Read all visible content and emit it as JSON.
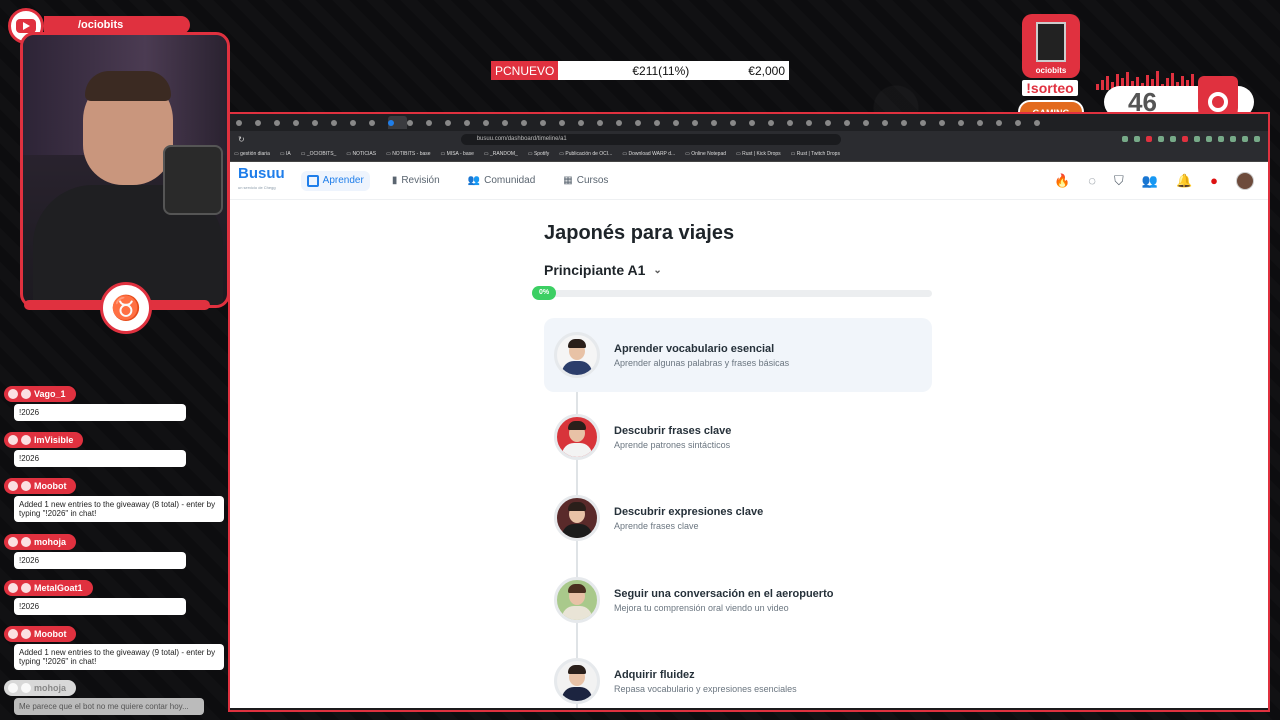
{
  "overlay": {
    "channel": "/ociobits",
    "donation": {
      "label": "PCNUEVO",
      "progress": "€211(11%)",
      "goal": "€2,000"
    },
    "sorteo_label": "!sorteo",
    "sorteo_brand": "ociobits",
    "gaming_label": "GAMING",
    "viewer_count": "46",
    "chat": [
      {
        "user": "Vago_1",
        "text": "!2026"
      },
      {
        "user": "ImVisible",
        "text": "!2026"
      },
      {
        "user": "Moobot",
        "text": "Added 1 new entries to the giveaway (8 total) - enter by typing \"!2026\" in chat!"
      },
      {
        "user": "mohoja",
        "text": "!2026"
      },
      {
        "user": "MetalGoat1",
        "text": "!2026"
      },
      {
        "user": "Moobot",
        "text": "Added 1 new entries to the giveaway (9 total) - enter by typing \"!2026\" in chat!"
      },
      {
        "user": "mohoja",
        "text": "Me parece que el bot no me quiere contar hoy..."
      }
    ]
  },
  "browser": {
    "url": "busuu.com/dashboard/timeline/a1",
    "bookmarks": [
      "gestión diaria",
      "IA",
      "_OCIOBITS_",
      "NOTICIAS",
      "NOTIBITS - base",
      "MISA - base",
      "_RANDOM_",
      "Spotify",
      "Publicación de OCI...",
      "Download WARP d...",
      "Online Notepad",
      "Rust | Kick Drops",
      "Rust | Twitch Drops"
    ]
  },
  "busuu": {
    "logo": "Busuu",
    "logo_sub": "un servicio de Chegg",
    "nav": {
      "learn": "Aprender",
      "review": "Revisión",
      "community": "Comunidad",
      "courses": "Cursos"
    },
    "course_title": "Japonés para viajes",
    "level": "Principiante A1",
    "progress_label": "0%",
    "progress_value": 0,
    "lessons": [
      {
        "title": "Aprender vocabulario esencial",
        "subtitle": "Aprender algunas palabras y frases básicas"
      },
      {
        "title": "Descubrir frases clave",
        "subtitle": "Aprende patrones sintácticos"
      },
      {
        "title": "Descubrir expresiones clave",
        "subtitle": "Aprende frases clave"
      },
      {
        "title": "Seguir una conversación en el aeropuerto",
        "subtitle": "Mejora tu comprensión oral viendo un video"
      },
      {
        "title": "Adquirir fluidez",
        "subtitle": "Repasa vocabulario y expresiones esenciales"
      }
    ]
  },
  "colors": {
    "brand_red": "#e0313f",
    "busuu_blue": "#1f7eea",
    "progress_green": "#3ccf63"
  }
}
